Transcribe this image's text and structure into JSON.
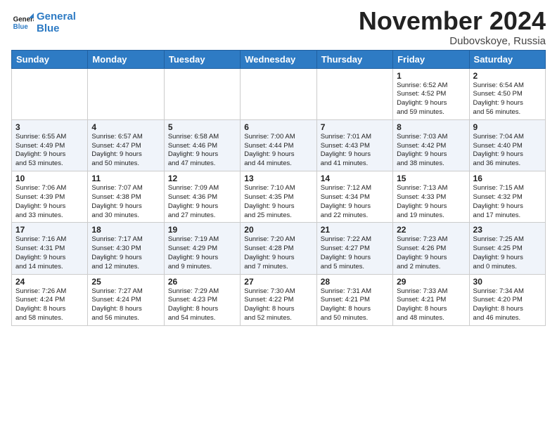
{
  "header": {
    "logo_line1": "General",
    "logo_line2": "Blue",
    "month_title": "November 2024",
    "location": "Dubovskoye, Russia"
  },
  "weekdays": [
    "Sunday",
    "Monday",
    "Tuesday",
    "Wednesday",
    "Thursday",
    "Friday",
    "Saturday"
  ],
  "weeks": [
    [
      {
        "day": "",
        "info": ""
      },
      {
        "day": "",
        "info": ""
      },
      {
        "day": "",
        "info": ""
      },
      {
        "day": "",
        "info": ""
      },
      {
        "day": "",
        "info": ""
      },
      {
        "day": "1",
        "info": "Sunrise: 6:52 AM\nSunset: 4:52 PM\nDaylight: 9 hours\nand 59 minutes."
      },
      {
        "day": "2",
        "info": "Sunrise: 6:54 AM\nSunset: 4:50 PM\nDaylight: 9 hours\nand 56 minutes."
      }
    ],
    [
      {
        "day": "3",
        "info": "Sunrise: 6:55 AM\nSunset: 4:49 PM\nDaylight: 9 hours\nand 53 minutes."
      },
      {
        "day": "4",
        "info": "Sunrise: 6:57 AM\nSunset: 4:47 PM\nDaylight: 9 hours\nand 50 minutes."
      },
      {
        "day": "5",
        "info": "Sunrise: 6:58 AM\nSunset: 4:46 PM\nDaylight: 9 hours\nand 47 minutes."
      },
      {
        "day": "6",
        "info": "Sunrise: 7:00 AM\nSunset: 4:44 PM\nDaylight: 9 hours\nand 44 minutes."
      },
      {
        "day": "7",
        "info": "Sunrise: 7:01 AM\nSunset: 4:43 PM\nDaylight: 9 hours\nand 41 minutes."
      },
      {
        "day": "8",
        "info": "Sunrise: 7:03 AM\nSunset: 4:42 PM\nDaylight: 9 hours\nand 38 minutes."
      },
      {
        "day": "9",
        "info": "Sunrise: 7:04 AM\nSunset: 4:40 PM\nDaylight: 9 hours\nand 36 minutes."
      }
    ],
    [
      {
        "day": "10",
        "info": "Sunrise: 7:06 AM\nSunset: 4:39 PM\nDaylight: 9 hours\nand 33 minutes."
      },
      {
        "day": "11",
        "info": "Sunrise: 7:07 AM\nSunset: 4:38 PM\nDaylight: 9 hours\nand 30 minutes."
      },
      {
        "day": "12",
        "info": "Sunrise: 7:09 AM\nSunset: 4:36 PM\nDaylight: 9 hours\nand 27 minutes."
      },
      {
        "day": "13",
        "info": "Sunrise: 7:10 AM\nSunset: 4:35 PM\nDaylight: 9 hours\nand 25 minutes."
      },
      {
        "day": "14",
        "info": "Sunrise: 7:12 AM\nSunset: 4:34 PM\nDaylight: 9 hours\nand 22 minutes."
      },
      {
        "day": "15",
        "info": "Sunrise: 7:13 AM\nSunset: 4:33 PM\nDaylight: 9 hours\nand 19 minutes."
      },
      {
        "day": "16",
        "info": "Sunrise: 7:15 AM\nSunset: 4:32 PM\nDaylight: 9 hours\nand 17 minutes."
      }
    ],
    [
      {
        "day": "17",
        "info": "Sunrise: 7:16 AM\nSunset: 4:31 PM\nDaylight: 9 hours\nand 14 minutes."
      },
      {
        "day": "18",
        "info": "Sunrise: 7:17 AM\nSunset: 4:30 PM\nDaylight: 9 hours\nand 12 minutes."
      },
      {
        "day": "19",
        "info": "Sunrise: 7:19 AM\nSunset: 4:29 PM\nDaylight: 9 hours\nand 9 minutes."
      },
      {
        "day": "20",
        "info": "Sunrise: 7:20 AM\nSunset: 4:28 PM\nDaylight: 9 hours\nand 7 minutes."
      },
      {
        "day": "21",
        "info": "Sunrise: 7:22 AM\nSunset: 4:27 PM\nDaylight: 9 hours\nand 5 minutes."
      },
      {
        "day": "22",
        "info": "Sunrise: 7:23 AM\nSunset: 4:26 PM\nDaylight: 9 hours\nand 2 minutes."
      },
      {
        "day": "23",
        "info": "Sunrise: 7:25 AM\nSunset: 4:25 PM\nDaylight: 9 hours\nand 0 minutes."
      }
    ],
    [
      {
        "day": "24",
        "info": "Sunrise: 7:26 AM\nSunset: 4:24 PM\nDaylight: 8 hours\nand 58 minutes."
      },
      {
        "day": "25",
        "info": "Sunrise: 7:27 AM\nSunset: 4:24 PM\nDaylight: 8 hours\nand 56 minutes."
      },
      {
        "day": "26",
        "info": "Sunrise: 7:29 AM\nSunset: 4:23 PM\nDaylight: 8 hours\nand 54 minutes."
      },
      {
        "day": "27",
        "info": "Sunrise: 7:30 AM\nSunset: 4:22 PM\nDaylight: 8 hours\nand 52 minutes."
      },
      {
        "day": "28",
        "info": "Sunrise: 7:31 AM\nSunset: 4:21 PM\nDaylight: 8 hours\nand 50 minutes."
      },
      {
        "day": "29",
        "info": "Sunrise: 7:33 AM\nSunset: 4:21 PM\nDaylight: 8 hours\nand 48 minutes."
      },
      {
        "day": "30",
        "info": "Sunrise: 7:34 AM\nSunset: 4:20 PM\nDaylight: 8 hours\nand 46 minutes."
      }
    ]
  ]
}
